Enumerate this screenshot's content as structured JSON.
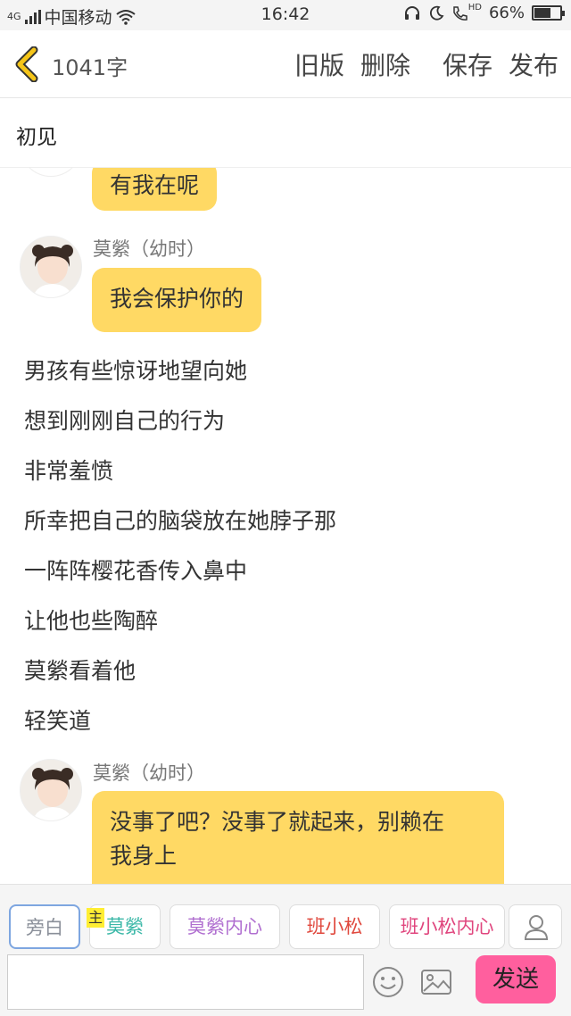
{
  "status_bar": {
    "network": "4G",
    "carrier": "中国移动",
    "time": "16:42",
    "hd_label": "HD",
    "battery": "66%",
    "battery_level": 0.66
  },
  "nav": {
    "word_count": "1041字",
    "actions": [
      "旧版",
      "删除",
      "保存",
      "发布"
    ]
  },
  "chapter_title": "初见",
  "messages": [
    {
      "type": "bubble",
      "text": "有我在呢"
    },
    {
      "type": "dialogue",
      "speaker": "莫縈（幼时）",
      "text": "我会保护你的"
    },
    {
      "type": "narration",
      "text": "男孩有些惊讶地望向她"
    },
    {
      "type": "narration",
      "text": "想到刚刚自己的行为"
    },
    {
      "type": "narration",
      "text": "非常羞愤"
    },
    {
      "type": "narration",
      "text": "所幸把自己的脑袋放在她脖子那"
    },
    {
      "type": "narration",
      "text": "一阵阵樱花香传入鼻中"
    },
    {
      "type": "narration",
      "text": "让他也些陶醉"
    },
    {
      "type": "narration",
      "text": "莫縈看着他"
    },
    {
      "type": "narration",
      "text": "轻笑道"
    },
    {
      "type": "dialogue",
      "speaker": "莫縈（幼时）",
      "text_line1": "没事了吧？没事了就起来，别赖在",
      "text_line2": "我身上"
    }
  ],
  "roles": [
    {
      "label": "旁白",
      "color": "#8a8f99"
    },
    {
      "label": "莫縈",
      "color": "#3cb8a8",
      "tag": "主"
    },
    {
      "label": "莫縈内心",
      "color": "#b06fd0"
    },
    {
      "label": "班小松",
      "color": "#e0493e"
    },
    {
      "label": "班小松内心",
      "color": "#e0467e"
    }
  ],
  "input": {
    "placeholder": ""
  },
  "send_label": "发送",
  "colors": {
    "bubble": "#ffd964",
    "send": "#ff5f9e",
    "accent_back": "#f5c518"
  }
}
